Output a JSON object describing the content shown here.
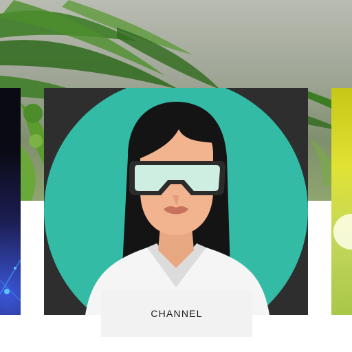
{
  "cards": {
    "main": {
      "label": "CHANNEL",
      "illustration": "woman-with-goggles-avatar",
      "circle_color": "#33bba6",
      "background_color": "#2e2e2e"
    },
    "left": {
      "image": "dark-blue-network-image"
    },
    "right": {
      "image": "yellow-green-bokeh-image"
    }
  },
  "hero": {
    "image": "green-leaves-banner"
  }
}
